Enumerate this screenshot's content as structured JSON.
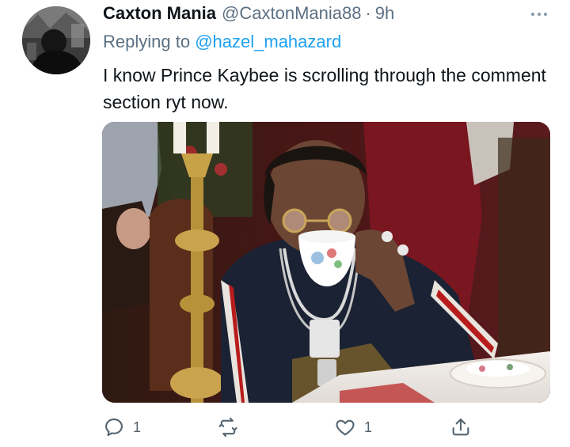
{
  "tweet": {
    "display_name": "Caxton Mania",
    "handle": "@CaxtonMania88",
    "separator": "·",
    "time": "9h",
    "replying_prefix": "Replying to",
    "replying_to": "@hazel_mahazard",
    "text": "I know Prince Kaybee is scrolling through the comment section ryt now."
  },
  "actions": {
    "reply_count": "1",
    "retweet_count": "",
    "like_count": "1"
  },
  "icons": {
    "more": "more-horizontal-icon",
    "reply": "comment-bubble-icon",
    "retweet": "retweet-arrows-icon",
    "like": "heart-icon",
    "share": "share-upload-icon"
  },
  "colors": {
    "text_primary": "#0f1419",
    "text_secondary": "#5b7083",
    "mention": "#1da1f2",
    "icon": "#536471"
  }
}
